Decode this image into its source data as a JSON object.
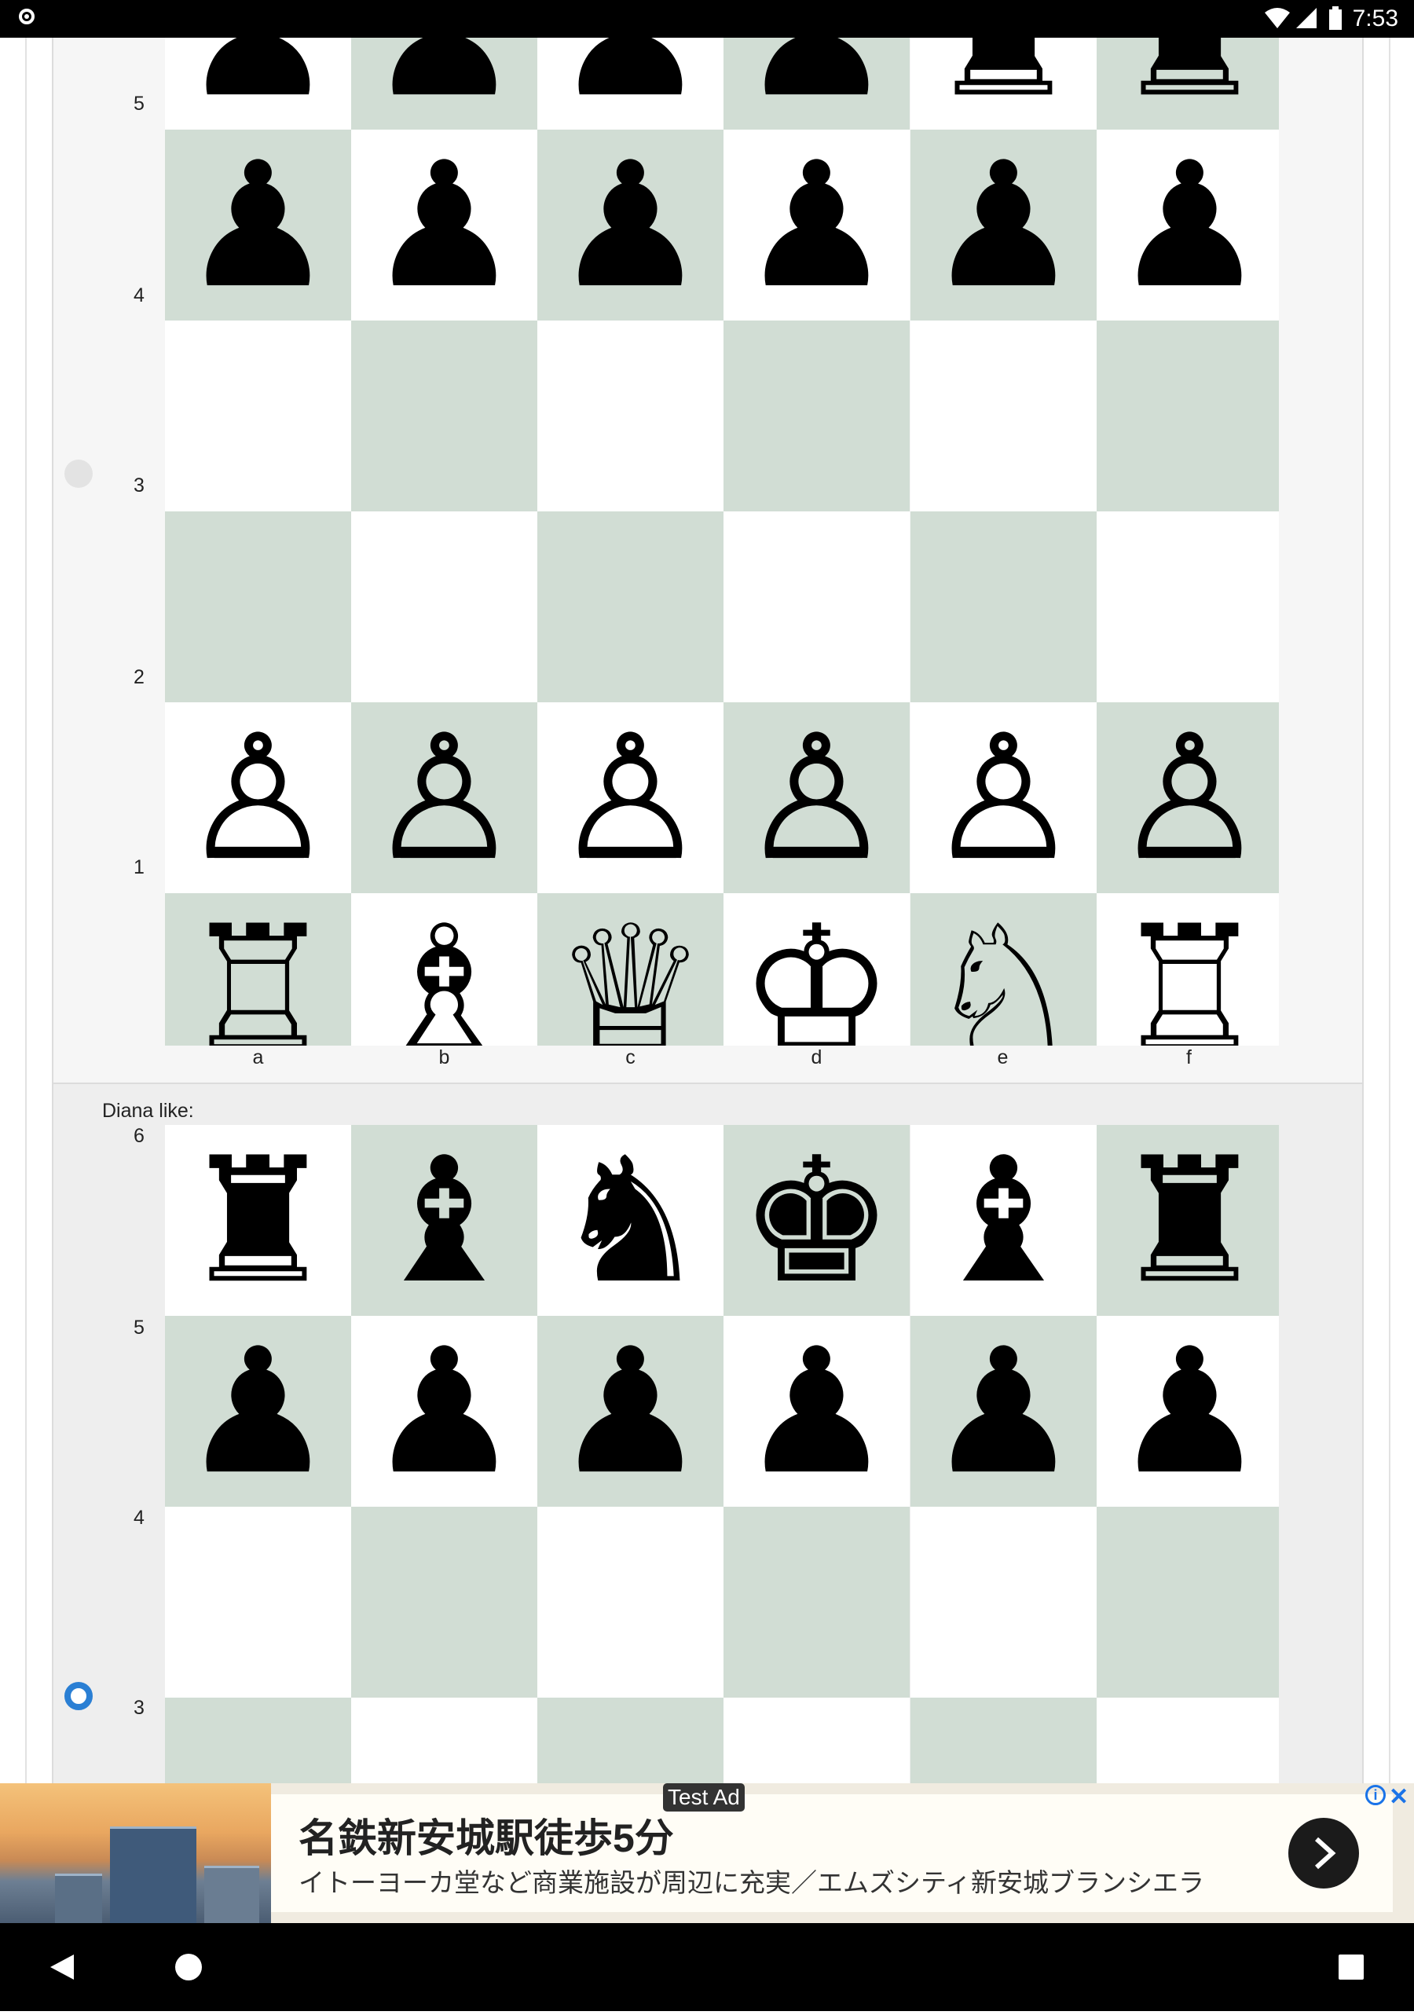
{
  "status_bar": {
    "time": "7:53"
  },
  "board_one": {
    "rank_labels": [
      "5",
      "4",
      "3",
      "2",
      "1"
    ],
    "file_labels": [
      "a",
      "b",
      "c",
      "d",
      "e",
      "f"
    ],
    "rows": [
      [
        "♟",
        "♟",
        "♟",
        "♟",
        "♜",
        "♜"
      ],
      [
        "♟",
        "♟",
        "♟",
        "♟",
        "♟",
        "♟"
      ],
      [
        "",
        "",
        "",
        "",
        "",
        ""
      ],
      [
        "",
        "",
        "",
        "",
        "",
        ""
      ],
      [
        "♙",
        "♙",
        "♙",
        "♙",
        "♙",
        "♙"
      ],
      [
        "♖",
        "♗",
        "♕",
        "♔",
        "♘",
        "♖"
      ]
    ]
  },
  "board_two": {
    "label": "Diana like:",
    "rank_labels": [
      "6",
      "5",
      "4",
      "3"
    ],
    "rows": [
      [
        "♜",
        "♝",
        "♞",
        "♚",
        "♝",
        "♜"
      ],
      [
        "♟",
        "♟",
        "♟",
        "♟",
        "♟",
        "♟"
      ],
      [
        "",
        "",
        "",
        "",
        "",
        ""
      ],
      [
        "",
        "",
        "",
        "",
        "",
        ""
      ]
    ]
  },
  "ad": {
    "tag": "Test Ad",
    "title": "名鉄新安城駅徒歩5分",
    "subtitle": "イトーヨーカ堂など商業施設が周辺に充実／エムズシティ新安城ブランシエラ",
    "info_icon": "i",
    "close_icon": "✕"
  },
  "colors": {
    "light_square": "#ffffff",
    "dark_square": "#d1ddd4",
    "radio_selected": "#2a7fd4"
  }
}
